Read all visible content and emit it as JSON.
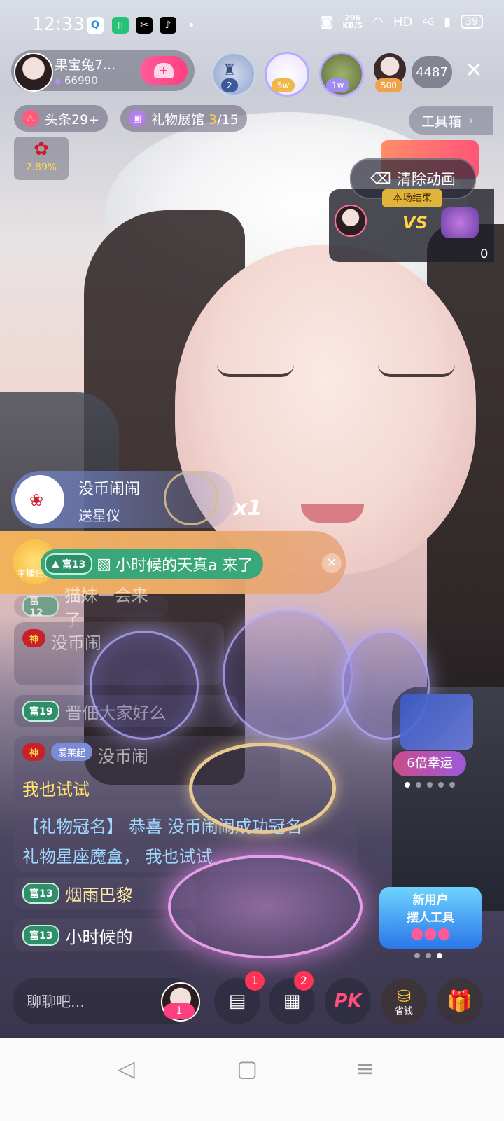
{
  "status_bar": {
    "time": "12:33",
    "app_icons": [
      "Q",
      "▯",
      "✂",
      "♪"
    ],
    "net_speed_top": "296",
    "net_speed_unit": "KB/S",
    "hd": "HD",
    "signal": "4G",
    "battery": "39"
  },
  "host": {
    "name": "果宝兔7...",
    "fans": "66990"
  },
  "ranks": [
    {
      "label": "2"
    },
    {
      "label": "5w"
    },
    {
      "label": "1w"
    },
    {
      "label": "500"
    }
  ],
  "viewer_count": "4487",
  "row2": {
    "headline": "头条29+",
    "gift_hall_prefix": "礼物展馆 ",
    "gift_hall_current": "3",
    "gift_hall_total": "/15",
    "toolbox": "工具箱"
  },
  "rose": {
    "percent": "2.89%"
  },
  "pk": {
    "clear_animation": "清除动画",
    "ended": "本场结束",
    "vs": "VS",
    "score": "0"
  },
  "gift_notice": {
    "user": "没币闹闹",
    "action": "送星仪",
    "multiplier": "x1"
  },
  "entry": {
    "task": "主播任务",
    "rich": "富13",
    "text": "小时候的天真a 来了"
  },
  "chat": [
    {
      "rich": "富12",
      "text": "猫妹一会来了"
    },
    {
      "god": "神",
      "text": "没币闹"
    },
    {
      "rich": "富19",
      "text": "晋佃大家好么"
    },
    {
      "god": "神",
      "love": "爱莱起",
      "text": "没币闹"
    },
    {
      "text": "我也试试"
    },
    {
      "sys": "【礼物冠名】",
      "text": "恭喜 没币闹闹成功冠名"
    },
    {
      "text": "礼物星座魔盒， 我也试试"
    },
    {
      "rich": "富13",
      "text": "烟雨巴黎"
    },
    {
      "rich": "富13",
      "text": "小时候的"
    }
  ],
  "promos": {
    "lucky": "6倍幸运",
    "new_user_1": "新用户",
    "new_user_2": "摆人工具"
  },
  "bottom": {
    "placeholder": "聊聊吧...",
    "badge_avatar": "1",
    "badge_chat": "1",
    "badge_apps": "2",
    "pk_label": "PK",
    "save_label": "省钱"
  },
  "colors": {
    "accent_pink": "#ff3f7f",
    "rich_green": "#3aa77a",
    "gold": "#ffd24a"
  }
}
